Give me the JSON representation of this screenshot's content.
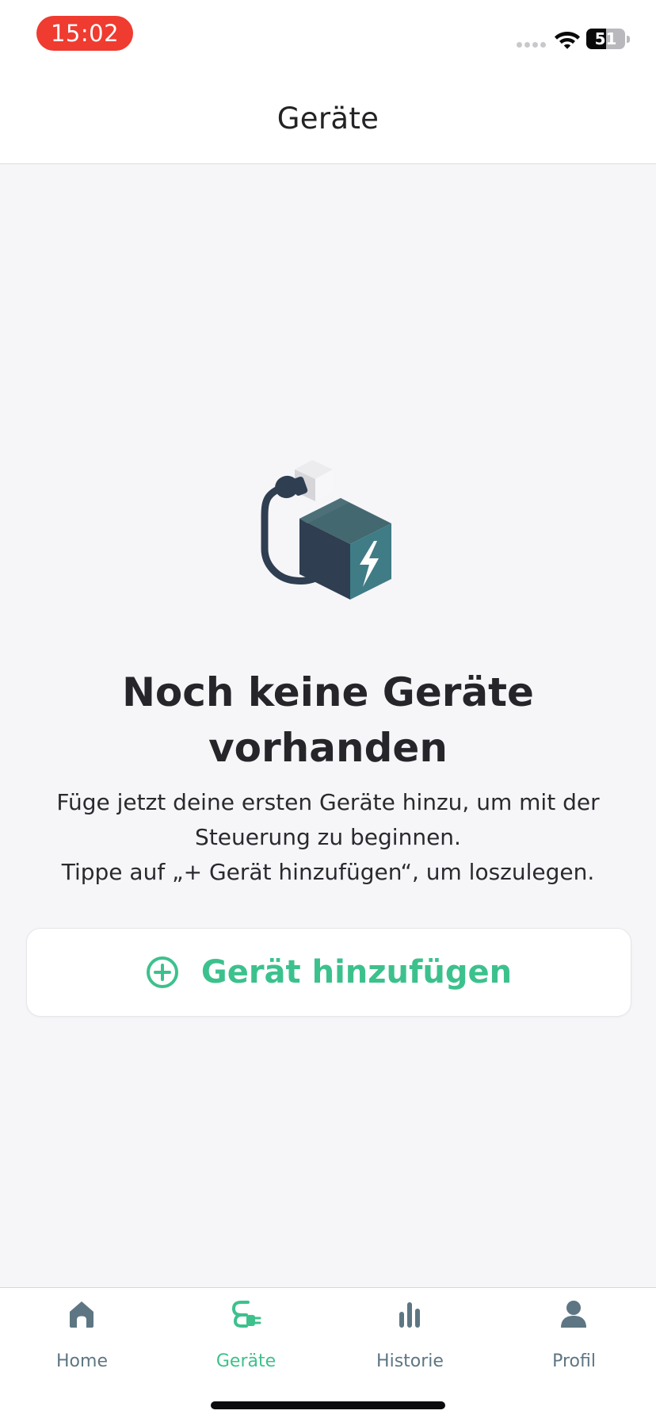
{
  "status_bar": {
    "time": "15:02",
    "battery_percent": 51,
    "battery_label": "51"
  },
  "header": {
    "title": "Geräte"
  },
  "empty_state": {
    "illustration": "plug-charger-illustration",
    "title_lines": [
      "Noch keine Geräte",
      "vorhanden"
    ],
    "description_lines": [
      "Füge jetzt deine ersten Geräte hinzu, um mit der",
      "Steuerung zu beginnen.",
      "Tippe auf „+ Gerät hinzufügen“, um loszulegen."
    ]
  },
  "add_button": {
    "label": "Gerät hinzufügen",
    "icon": "plus-circle-icon"
  },
  "tabs": [
    {
      "label": "Home",
      "icon": "home-icon",
      "active": false
    },
    {
      "label": "Geräte",
      "icon": "plug-icon",
      "active": true
    },
    {
      "label": "Historie",
      "icon": "bar-chart-icon",
      "active": false
    },
    {
      "label": "Profil",
      "icon": "person-icon",
      "active": false
    }
  ],
  "colors": {
    "accent": "#3cc18d",
    "inactive_tab": "#5e7683",
    "background": "#f6f5f8",
    "time_pill": "#ef3b30"
  }
}
